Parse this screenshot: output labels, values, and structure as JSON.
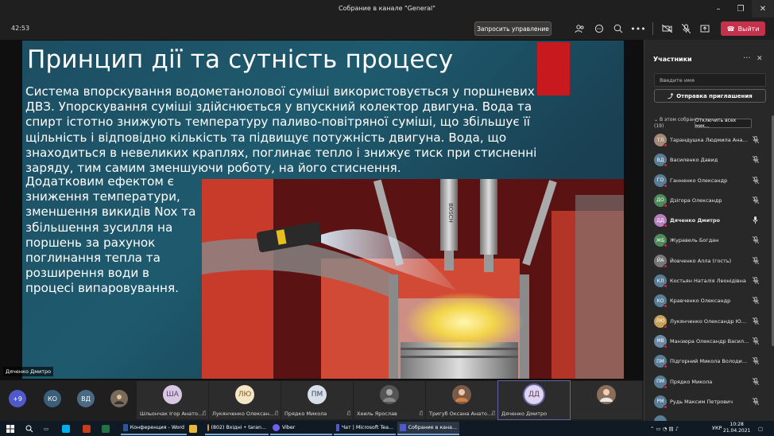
{
  "window": {
    "title": "Собрание в канале \"General\""
  },
  "toolbar": {
    "timer": "42:53",
    "request_control": "Запросить управление",
    "leave": "Выйти"
  },
  "slide": {
    "title": "Принцип дії та сутність процесу",
    "body": "Система впорскування водометанолової суміші використовується у поршневих ДВЗ. Упорскування суміші здійснюється у впускний колектор двигуна. Вода та спирт істотно знижують температуру паливо-повітряної суміші, що збільшує її щільність і відповідно кількість та підвищує потужність двигуна. Вода, що знаходиться в невеликих краплях, поглинає тепло і знижує тиск при стисненні заряду, тим самим зменшуючи роботу, на його стиснення.",
    "side": "Додатковим ефектом є зниження температури, зменшення викидів Nox та збільшення зусилля на поршень за рахунок поглинання тепла та розширення води в процесі випаровування.",
    "injector_brand": "BOSCH"
  },
  "presenter": {
    "name": "Дяченко Дмитро"
  },
  "gallery": {
    "overflow": "+9",
    "chips": [
      {
        "initials": "КО",
        "color": "#3b5f7a"
      },
      {
        "initials": "ВД",
        "color": "#4a6a82"
      }
    ],
    "tiles": [
      {
        "initials": "ША",
        "name": "Шльончак Ігор Анато...",
        "color": "#d9c8e3",
        "fg": "#5a3f70"
      },
      {
        "initials": "ЛЮ",
        "name": "Лукянченко Олексан...",
        "color": "#f5e6c8",
        "fg": "#7a5a20"
      },
      {
        "initials": "ПМ",
        "name": "Прядко Микола",
        "color": "#d8dfe8",
        "fg": "#2f4a66"
      },
      {
        "initials": "",
        "name": "Хеиль Ярослав",
        "color": "#555",
        "fg": "#fff"
      },
      {
        "initials": "",
        "name": "Тригуб Оксана Анато...",
        "color": "#7a5a48",
        "fg": "#fff"
      },
      {
        "initials": "ДД",
        "name": "Дяченко Дмитро",
        "color": "#e0d4ee",
        "fg": "#5a3f70"
      },
      {
        "initials": "",
        "name": "",
        "color": "#8a6d5a",
        "fg": "#fff"
      }
    ]
  },
  "panel": {
    "title": "Участники",
    "search_placeholder": "Введите имя",
    "invite": "Отправка приглашения",
    "section": "В этом собрании",
    "count": "(19)",
    "mute_all": "Отключить всех мик...",
    "participants": [
      {
        "initials": "ТЛ",
        "name": "Тарандушка Людмила Анато...",
        "color": "#a48a76",
        "mic": "muted"
      },
      {
        "initials": "ВД",
        "name": "Василенко Давид",
        "color": "#5a7d96",
        "mic": "muted"
      },
      {
        "initials": "ГО",
        "name": "Ганненко Олександр",
        "color": "#5a7d96",
        "mic": "muted"
      },
      {
        "initials": "ДО",
        "name": "Дзігора Олександр",
        "color": "#4f8a5a",
        "mic": "muted"
      },
      {
        "initials": "ДД",
        "name": "Дяченко Дмитро",
        "color": "#b87fbf",
        "mic": "on",
        "bold": true
      },
      {
        "initials": "ЖБ",
        "name": "Журавель Богдан",
        "color": "#4f8a5a",
        "mic": "muted"
      },
      {
        "initials": "ЙА",
        "name": "Йовченко Алла (гость)",
        "color": "#777",
        "mic": "muted"
      },
      {
        "initials": "КЛ",
        "name": "Костьян Наталія Леонідівна",
        "color": "#5a7d96",
        "mic": "muted"
      },
      {
        "initials": "КО",
        "name": "Кравченко Олександр",
        "color": "#5a7d96",
        "mic": "muted"
      },
      {
        "initials": "ЛЮ",
        "name": "Лукянченко Олександр Юрі...",
        "color": "#c9a25a",
        "mic": "muted"
      },
      {
        "initials": "МВ",
        "name": "Манзюра Олександр Василь...",
        "color": "#6c8aa8",
        "mic": "muted"
      },
      {
        "initials": "ПМ",
        "name": "Підгорний Микола Володим...",
        "color": "#5a7d96",
        "mic": "muted"
      },
      {
        "initials": "ПМ",
        "name": "Прядко Микола",
        "color": "#5a7d96",
        "mic": "muted"
      },
      {
        "initials": "РМ",
        "name": "Рудь Максим Петрович",
        "color": "#5a7d96",
        "mic": "muted"
      },
      {
        "initials": "",
        "name": "",
        "color": "#5a7d96",
        "mic": ""
      }
    ]
  },
  "taskbar": {
    "apps": [
      {
        "label": "Конференция - Word",
        "color": "#2b579a"
      },
      {
        "label": "(802) Вхідні • taran...",
        "color": "#e8a33c"
      },
      {
        "label": "Viber",
        "color": "#7360f2"
      },
      {
        "label": "Чат | Microsoft Tea...",
        "color": "#5059c9"
      },
      {
        "label": "Собрание в кана...",
        "color": "#5059c9"
      }
    ],
    "lang": "УКР",
    "time": "10:28",
    "date": "21.04.2021"
  }
}
